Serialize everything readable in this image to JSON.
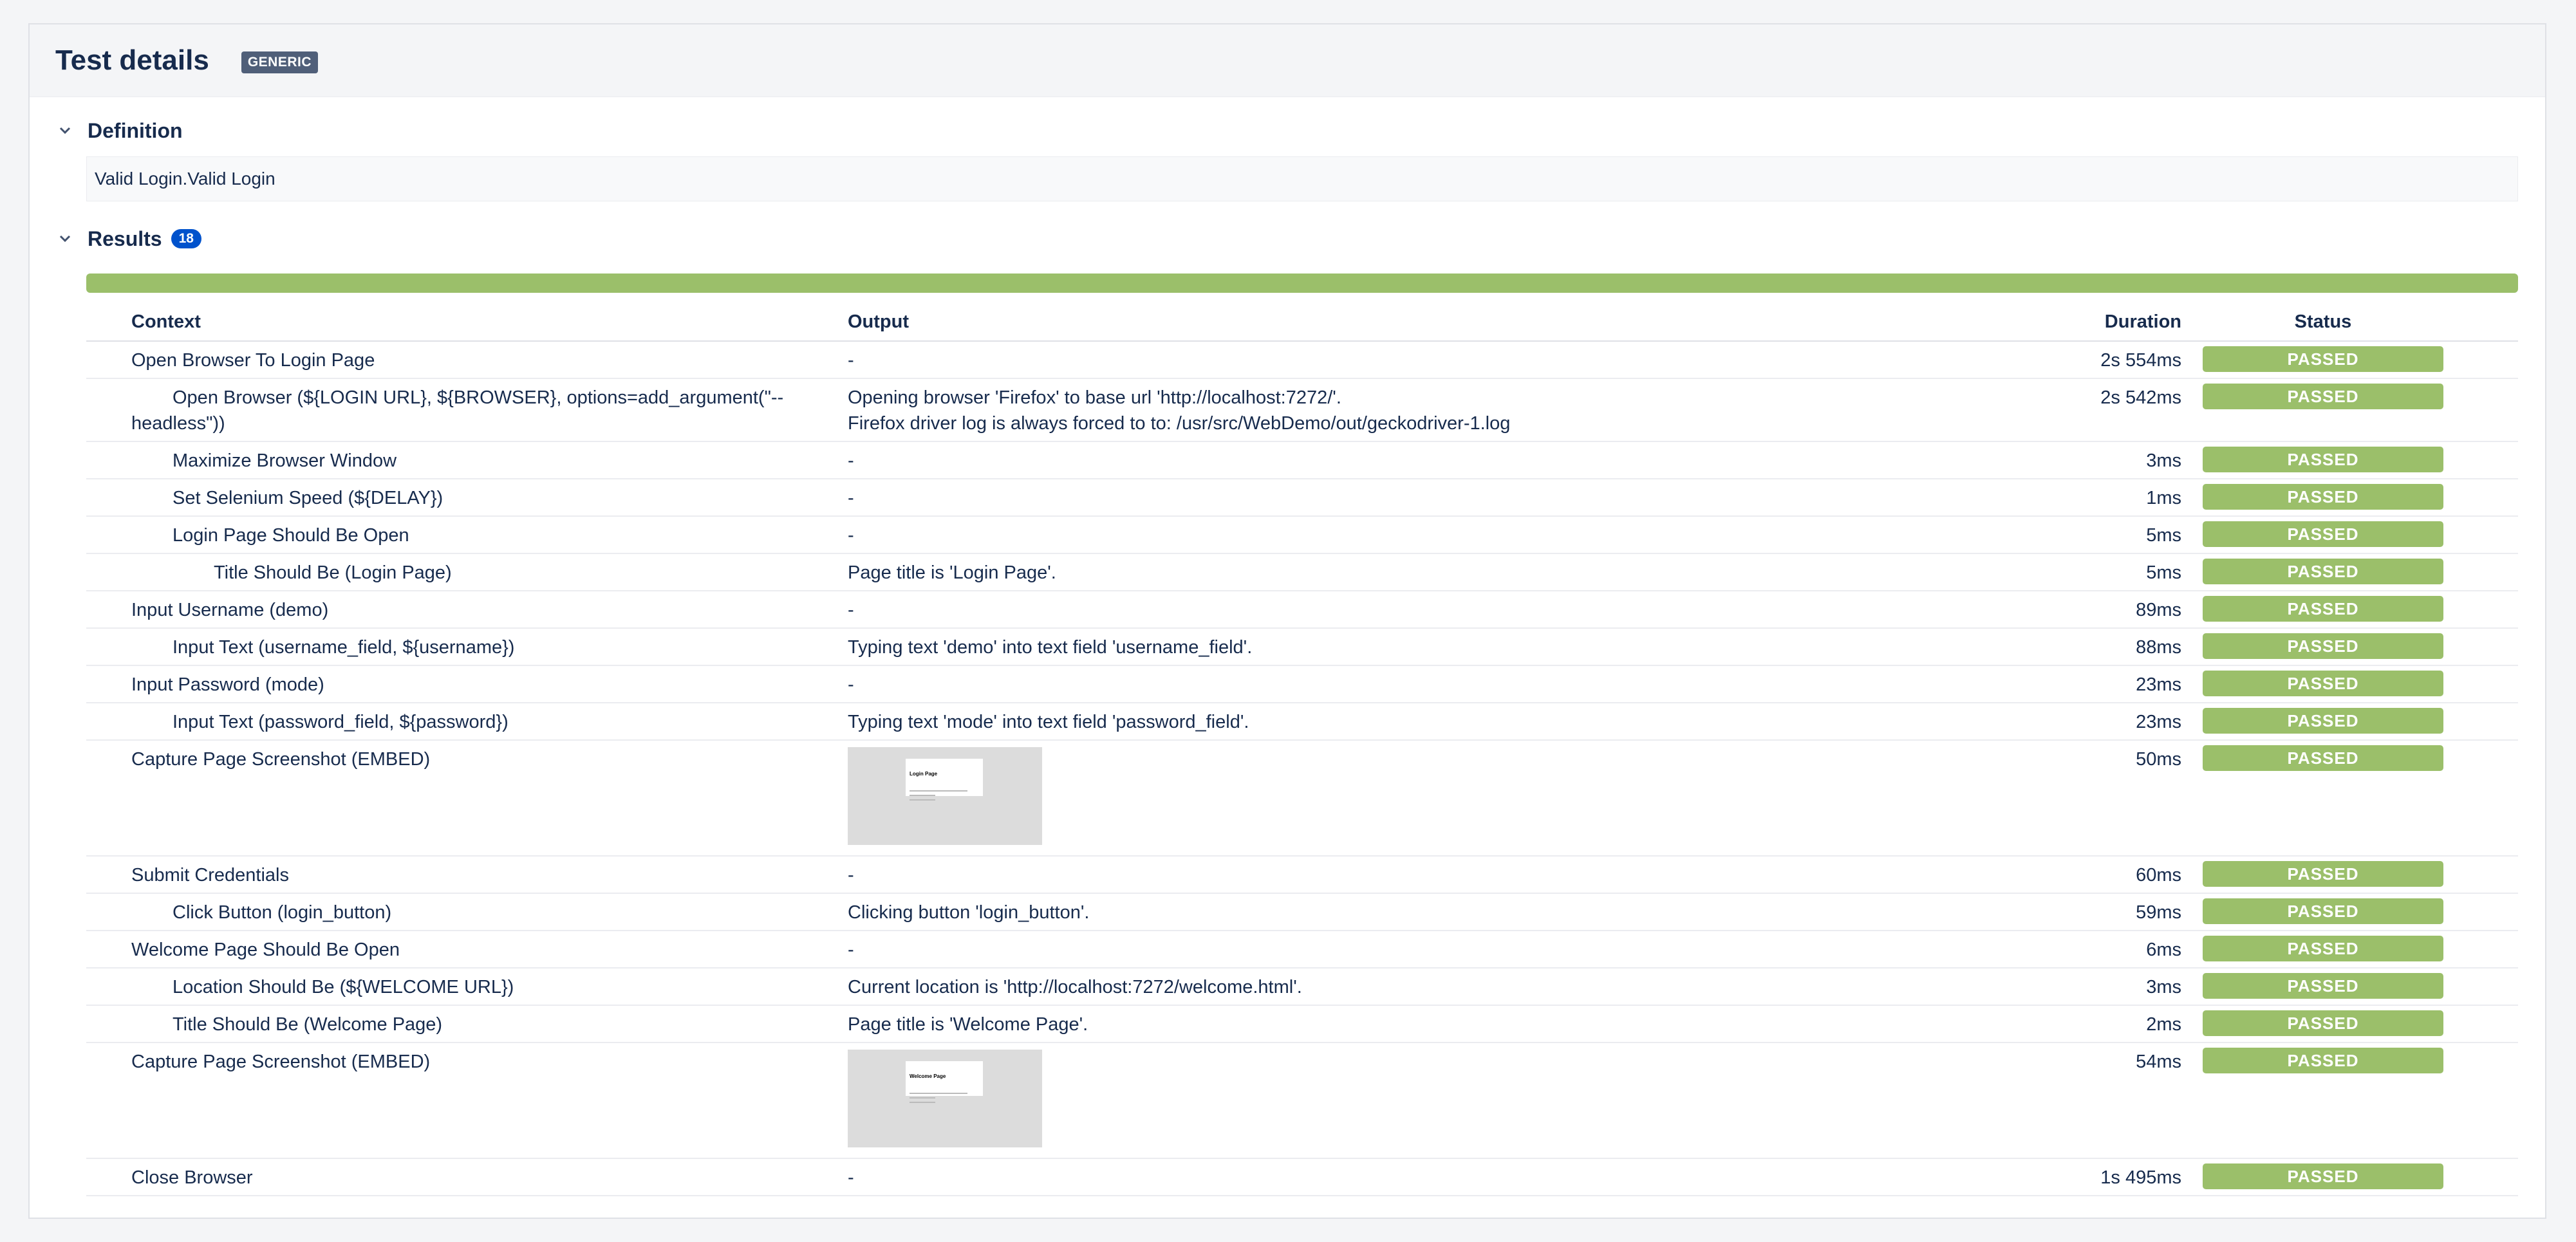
{
  "header": {
    "title": "Test details",
    "type_badge": "GENERIC"
  },
  "definition": {
    "title": "Definition",
    "text": "Valid Login.Valid Login"
  },
  "results": {
    "title": "Results",
    "count": "18",
    "progress_passed_fraction": 1.0,
    "columns": {
      "context": "Context",
      "output": "Output",
      "duration": "Duration",
      "status": "Status"
    },
    "rows": [
      {
        "context": "Open Browser To Login Page",
        "level": 0,
        "output": "-",
        "duration": "2s 554ms",
        "status": "PASSED"
      },
      {
        "context": "Open Browser (${LOGIN URL}, ${BROWSER}, options=add_argument(\"--headless\"))",
        "level": 1,
        "output": "Opening browser 'Firefox' to base url 'http://localhost:7272/'.",
        "output2": "Firefox driver log is always forced to to: /usr/src/WebDemo/out/geckodriver-1.log",
        "duration": "2s 542ms",
        "status": "PASSED"
      },
      {
        "context": "Maximize Browser Window",
        "level": 1,
        "output": "-",
        "duration": "3ms",
        "status": "PASSED"
      },
      {
        "context": "Set Selenium Speed (${DELAY})",
        "level": 1,
        "output": "-",
        "duration": "1ms",
        "status": "PASSED"
      },
      {
        "context": "Login Page Should Be Open",
        "level": 1,
        "output": "-",
        "duration": "5ms",
        "status": "PASSED"
      },
      {
        "context": "Title Should Be (Login Page)",
        "level": 2,
        "output": "Page title is 'Login Page'.",
        "duration": "5ms",
        "status": "PASSED"
      },
      {
        "context": "Input Username (demo)",
        "level": 0,
        "output": "-",
        "duration": "89ms",
        "status": "PASSED"
      },
      {
        "context": "Input Text (username_field, ${username})",
        "level": 1,
        "output": "Typing text 'demo' into text field 'username_field'.",
        "duration": "88ms",
        "status": "PASSED"
      },
      {
        "context": "Input Password (mode)",
        "level": 0,
        "output": "-",
        "duration": "23ms",
        "status": "PASSED"
      },
      {
        "context": "Input Text (password_field, ${password})",
        "level": 1,
        "output": "Typing text 'mode' into text field 'password_field'.",
        "duration": "23ms",
        "status": "PASSED"
      },
      {
        "context": "Capture Page Screenshot (EMBED)",
        "level": 0,
        "output_image": {
          "title": "Login Page"
        },
        "duration": "50ms",
        "status": "PASSED"
      },
      {
        "context": "Submit Credentials",
        "level": 0,
        "output": "-",
        "duration": "60ms",
        "status": "PASSED"
      },
      {
        "context": "Click Button (login_button)",
        "level": 1,
        "output": "Clicking button 'login_button'.",
        "duration": "59ms",
        "status": "PASSED"
      },
      {
        "context": "Welcome Page Should Be Open",
        "level": 0,
        "output": "-",
        "duration": "6ms",
        "status": "PASSED"
      },
      {
        "context": "Location Should Be (${WELCOME URL})",
        "level": 1,
        "output": "Current location is 'http://localhost:7272/welcome.html'.",
        "duration": "3ms",
        "status": "PASSED"
      },
      {
        "context": "Title Should Be (Welcome Page)",
        "level": 1,
        "output": "Page title is 'Welcome Page'.",
        "duration": "2ms",
        "status": "PASSED"
      },
      {
        "context": "Capture Page Screenshot (EMBED)",
        "level": 0,
        "output_image": {
          "title": "Welcome Page"
        },
        "duration": "54ms",
        "status": "PASSED"
      },
      {
        "context": "Close Browser",
        "level": 0,
        "output": "-",
        "duration": "1s 495ms",
        "status": "PASSED"
      }
    ]
  },
  "colors": {
    "passed": "#9bbf6a",
    "count_badge": "#0052cc",
    "type_badge": "#505f79"
  },
  "icons": {
    "section_toggle": "chevron-down-icon"
  }
}
